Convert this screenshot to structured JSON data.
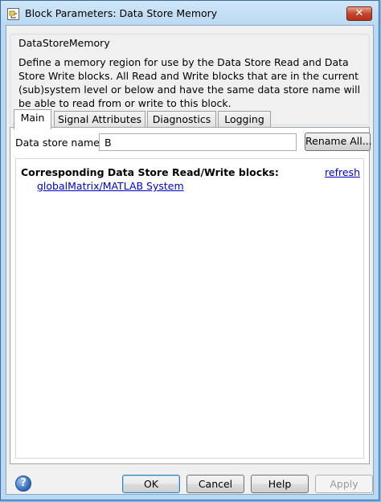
{
  "window": {
    "title": "Block Parameters: Data Store Memory",
    "close_glyph": "✕"
  },
  "block": {
    "type_name": "DataStoreMemory",
    "description": "Define a memory region for use by the Data Store Read and Data Store Write blocks. All Read and Write blocks that are in the current (sub)system level or below and have the same data store name will be able to read from or write to this block."
  },
  "tabs": [
    {
      "label": "Main",
      "active": true
    },
    {
      "label": "Signal Attributes",
      "active": false
    },
    {
      "label": "Diagnostics",
      "active": false
    },
    {
      "label": "Logging",
      "active": false
    }
  ],
  "main": {
    "name_label": "Data store name:",
    "name_value": "B",
    "rename_label": "Rename All...",
    "blocks_heading": "Corresponding Data Store Read/Write blocks:",
    "refresh_label": "refresh",
    "blocks": [
      "globalMatrix/MATLAB System"
    ]
  },
  "buttons": {
    "ok": "OK",
    "cancel": "Cancel",
    "help": "Help",
    "apply": "Apply",
    "help_icon": "?"
  },
  "icons": {
    "app": "simulink-block-icon",
    "help": "help-icon",
    "close": "close-icon"
  }
}
